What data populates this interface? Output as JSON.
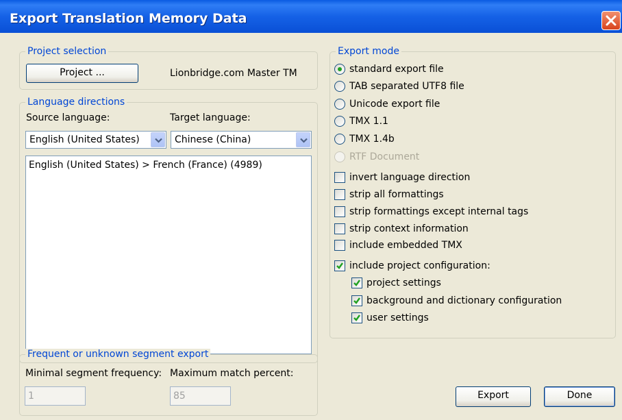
{
  "window": {
    "title": "Export Translation Memory Data"
  },
  "project_selection": {
    "group_label": "Project selection",
    "button_label": "Project ...",
    "project_name": "Lionbridge.com Master TM"
  },
  "language_directions": {
    "group_label": "Language directions",
    "source_label": "Source language:",
    "target_label": "Target language:",
    "source_value": "English (United States)",
    "target_value": "Chinese (China)",
    "list_items": [
      "English (United States) > French (France) (4989)"
    ]
  },
  "segment_export": {
    "group_label": "Frequent or unknown segment export",
    "min_freq_label": "Minimal segment frequency:",
    "max_match_label": "Maximum match percent:",
    "min_freq_value": "1",
    "max_match_value": "85"
  },
  "export_mode": {
    "group_label": "Export mode",
    "radios": [
      {
        "label": "standard export file",
        "selected": true,
        "enabled": true
      },
      {
        "label": "TAB separated UTF8 file",
        "selected": false,
        "enabled": true
      },
      {
        "label": "Unicode export file",
        "selected": false,
        "enabled": true
      },
      {
        "label": "TMX 1.1",
        "selected": false,
        "enabled": true
      },
      {
        "label": "TMX 1.4b",
        "selected": false,
        "enabled": true
      },
      {
        "label": "RTF Document",
        "selected": false,
        "enabled": false
      }
    ],
    "checkboxes": [
      {
        "label": "invert language direction",
        "checked": false
      },
      {
        "label": "strip all formattings",
        "checked": false
      },
      {
        "label": "strip formattings except internal tags",
        "checked": false
      },
      {
        "label": "strip context information",
        "checked": false
      },
      {
        "label": "include embedded TMX",
        "checked": false
      },
      {
        "label": "include project configuration:",
        "checked": true
      },
      {
        "label": "project settings",
        "checked": true
      },
      {
        "label": "background and dictionary configuration",
        "checked": true
      },
      {
        "label": "user settings",
        "checked": true
      }
    ]
  },
  "buttons": {
    "export_label": "Export",
    "done_label": "Done"
  },
  "colors": {
    "titlebar": "#0a5be2",
    "group_label": "#0046d5",
    "check_mark": "#21a121",
    "close_button": "#d8431d"
  }
}
